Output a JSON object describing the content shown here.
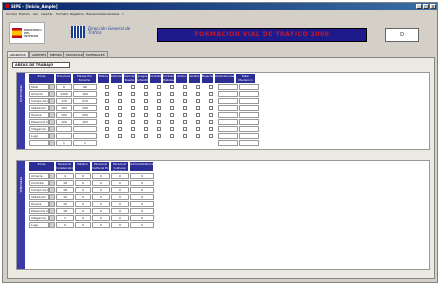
{
  "window": {
    "title": "SIPE - [Inicio_Ample]"
  },
  "menu": [
    "Archivo",
    "Edición",
    "Ver",
    "Insertar",
    "Formato",
    "Registros",
    "Herramientas",
    "Ventana",
    "?"
  ],
  "banner": {
    "logo1_text": "MINISTERIO DEL INTERIOR",
    "logo2_text": "Dirección General de Tráfico",
    "title": "FORMACIÓN VIAL DE TRÁFICO 2006",
    "selector": "D"
  },
  "tabs": [
    "APARATOS",
    "AGENTES",
    "MEDIOS",
    "MOVILIDAD",
    "MATERIALES"
  ],
  "section1": {
    "title": "AREAS DE TRABAJO",
    "side_label": "VEHICULOS",
    "headers": [
      "Zona",
      "Turismos",
      "Plazas Por Turismo",
      "Motos",
      "Camiones",
      "Camion Rueda",
      "Juegos Infantil",
      "Ciclistas",
      "Ciclistas Hábiles",
      "Autos",
      "Grafos",
      "Bujerías",
      "Ambulancias",
      "Taller Mecánico"
    ],
    "rows": [
      {
        "label": "Total",
        "v1": "6",
        "v2": "86"
      },
      {
        "label": "Almería",
        "v1": "1000",
        "v2": "100"
      },
      {
        "label": "Campo de la Zona",
        "v1": "170",
        "v2": "270"
      },
      {
        "label": "Valladolid",
        "v1": "100",
        "v2": "290"
      },
      {
        "label": "Huelva",
        "v1": "100",
        "v2": "200"
      },
      {
        "label": "Plasencia Cabecera",
        "v1": "100",
        "v2": "103"
      },
      {
        "label": "Vilagarcia",
        "v1": "",
        "v2": ""
      },
      {
        "label": "Lugo",
        "v1": "",
        "v2": ""
      },
      {
        "label": "",
        "v1": "1",
        "v2": "1"
      }
    ]
  },
  "section2": {
    "side_label": "PERSONAL",
    "headers": [
      "Zona",
      "Personal Colaborador",
      "Médico",
      "Personal Cultural Pl.",
      "Personal Cultural Eventual",
      "Administrativos"
    ],
    "rows": [
      {
        "label": "Almería",
        "vals": [
          "4",
          "0",
          "0",
          "0",
          "0"
        ]
      },
      {
        "label": "Córdoba",
        "vals": [
          "18",
          "0",
          "0",
          "0",
          "0"
        ]
      },
      {
        "label": "Campo de la Zona",
        "vals": [
          "18",
          "0",
          "0",
          "0",
          "0"
        ]
      },
      {
        "label": "Valladolid",
        "vals": [
          "10",
          "0",
          "0",
          "0",
          "0"
        ]
      },
      {
        "label": "Huelva",
        "vals": [
          "10",
          "0",
          "0",
          "0",
          "0"
        ]
      },
      {
        "label": "Plasencia Cabecera",
        "vals": [
          "18",
          "0",
          "0",
          "0",
          "0"
        ]
      },
      {
        "label": "Vilagarcia",
        "vals": [
          "1",
          "0",
          "0",
          "0",
          "0"
        ]
      },
      {
        "label": "Lugo",
        "vals": [
          "0",
          "0",
          "0",
          "0",
          "0"
        ]
      }
    ]
  }
}
